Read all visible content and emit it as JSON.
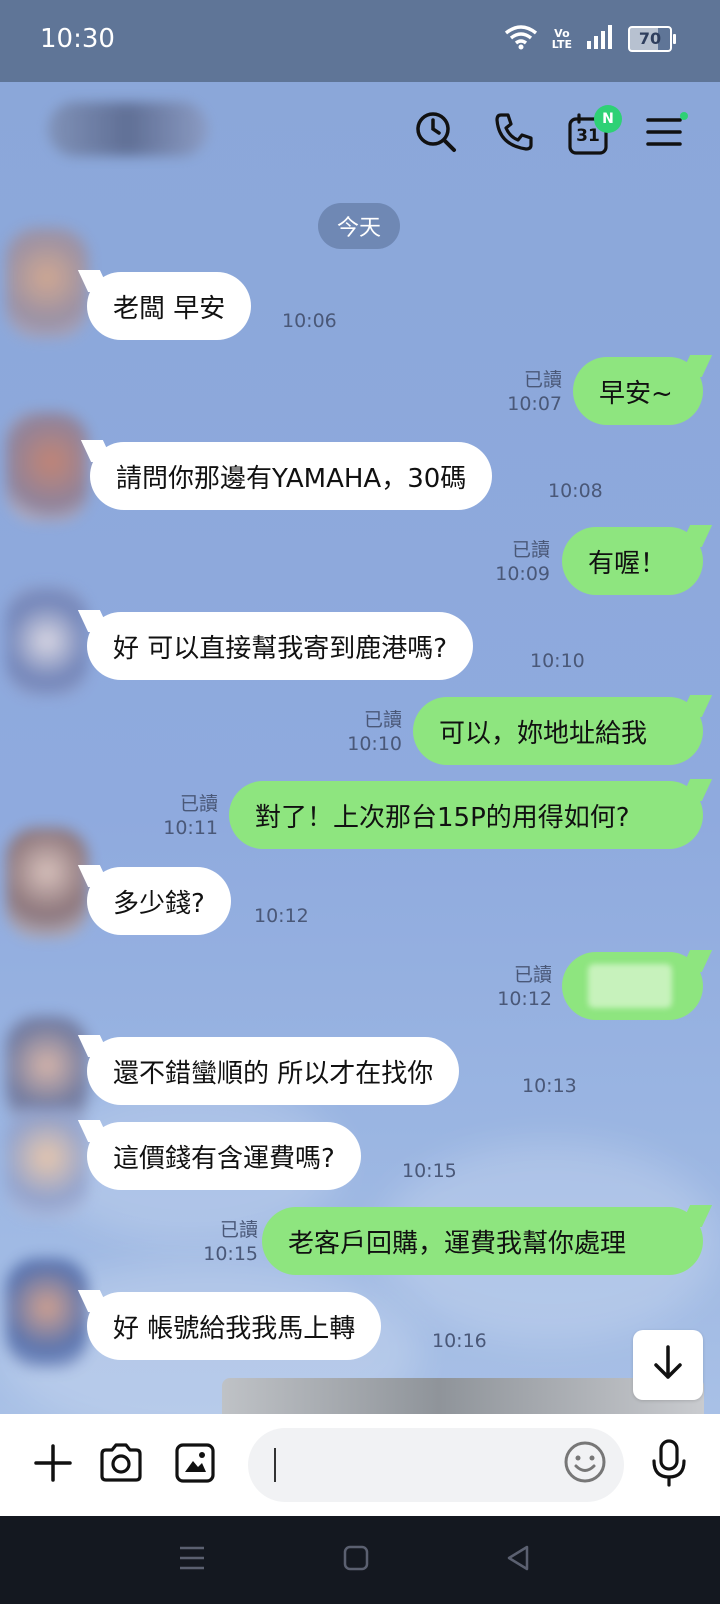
{
  "status_bar": {
    "time": "10:30",
    "volte_top": "Vo",
    "volte_bottom": "LTE",
    "battery": "70",
    "battery_level": 0.7
  },
  "header": {
    "icons": [
      "clock-search-icon",
      "phone-icon",
      "calendar-icon",
      "menu-icon"
    ],
    "calendar_day": "31",
    "calendar_badge": "N"
  },
  "date_label": "今天",
  "read_label": "已讀",
  "messages": [
    {
      "side": "in",
      "text": "老闆  早安",
      "time": "10:06"
    },
    {
      "side": "out",
      "text": "早安~",
      "time": "10:07",
      "read": "已讀"
    },
    {
      "side": "in",
      "text": "請問你那邊有YAMAHA，30碼",
      "time": "10:08"
    },
    {
      "side": "out",
      "text": "有喔！",
      "time": "10:09",
      "read": "已讀"
    },
    {
      "side": "in",
      "text": "好 可以直接幫我寄到鹿港嗎?",
      "time": "10:10"
    },
    {
      "side": "out",
      "text": "可以，妳地址給我",
      "time": "10:10",
      "read": "已讀"
    },
    {
      "side": "out",
      "text": "對了！上次那台15P的用得如何?",
      "time": "10:11",
      "read": "已讀"
    },
    {
      "side": "in",
      "text": "多少錢?",
      "time": "10:12"
    },
    {
      "side": "out",
      "text": "",
      "time": "10:12",
      "read": "已讀",
      "redacted": true
    },
    {
      "side": "in",
      "text": "還不錯蠻順的  所以才在找你",
      "time": "10:13"
    },
    {
      "side": "in",
      "text": "這價錢有含運費嗎?",
      "time": "10:15"
    },
    {
      "side": "out",
      "text": "老客戶回購，運費我幫你處理",
      "time": "10:15",
      "read": "已讀"
    },
    {
      "side": "in",
      "text": "好  帳號給我我馬上轉",
      "time": "10:16"
    }
  ],
  "input": {
    "placeholder": ""
  },
  "colors": {
    "chat_bg": "#8aa6d8",
    "out_bubble": "#8ee57f",
    "in_bubble": "#ffffff",
    "badge": "#2ed175"
  }
}
